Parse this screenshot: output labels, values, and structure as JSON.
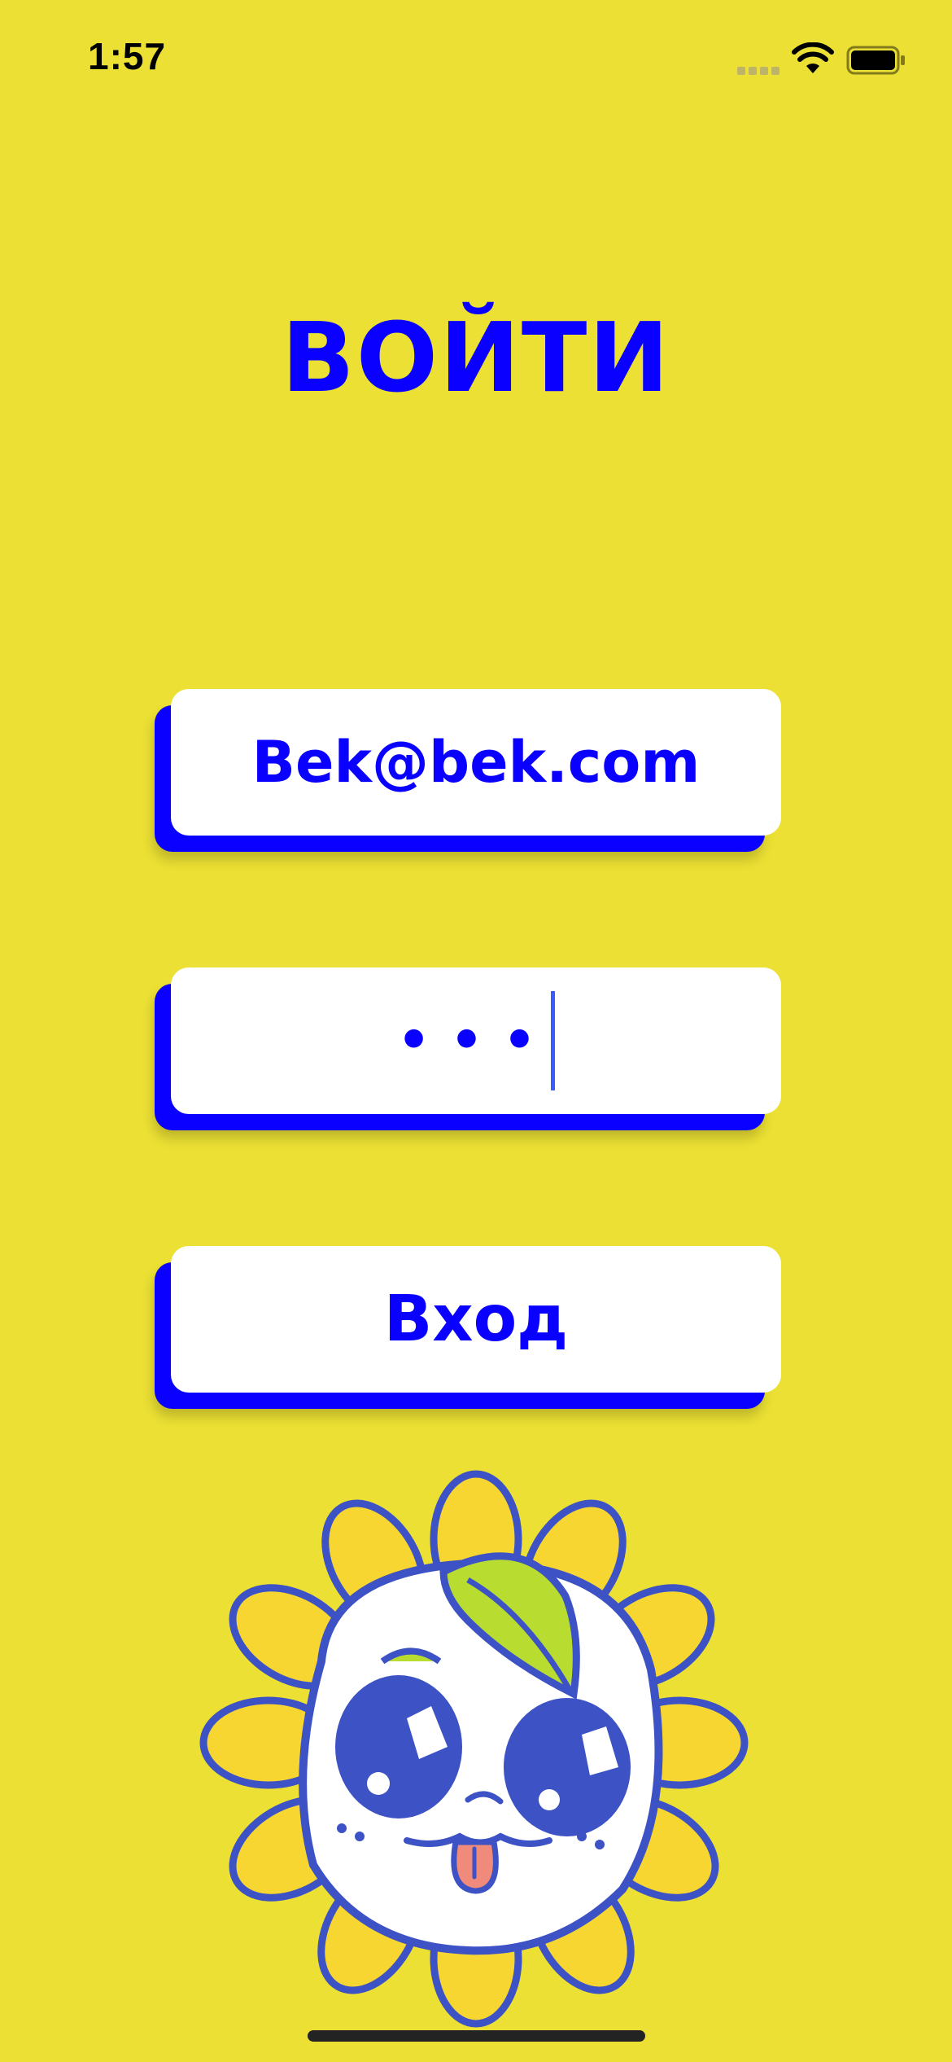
{
  "status_bar": {
    "time": "1:57",
    "icons": [
      "cellular-signal-icon",
      "wifi-icon",
      "battery-icon"
    ]
  },
  "screen": {
    "title": "ВОЙТИ"
  },
  "form": {
    "email_value": "Bek@bek.com",
    "password_masked": "•••",
    "login_button_label": "Вход"
  },
  "illustration": {
    "icon": "flower-mascot-icon"
  },
  "colors": {
    "background": "#ebe033",
    "accent": "#0a00ff",
    "field": "#ffffff",
    "mascot_outline": "#3d52c4",
    "petal": "#f7d632",
    "leaf": "#b8dc30",
    "tongue": "#f08a7a"
  }
}
